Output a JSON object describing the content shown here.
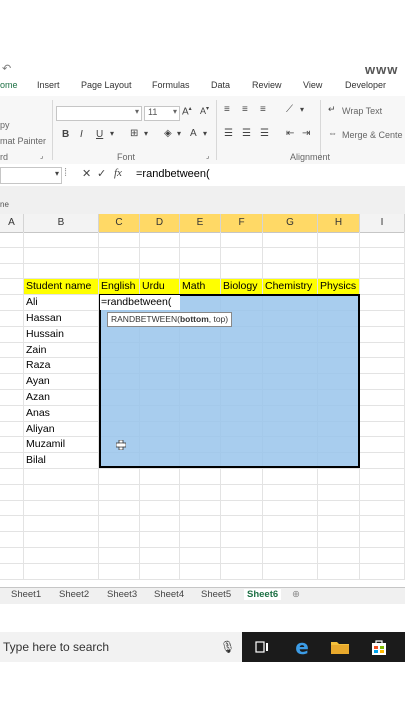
{
  "watermark": "www",
  "ribbon_tabs": [
    "ome",
    "Insert",
    "Page Layout",
    "Formulas",
    "Data",
    "Review",
    "View",
    "Developer"
  ],
  "ribbon": {
    "copy_label": "py",
    "painter_label": "mat Painter",
    "clipboard_group": "rd",
    "font_size": "11",
    "font_group": "Font",
    "wrap_text": "Wrap Text",
    "merge_center": "Merge & Cente",
    "alignment_group": "Alignment"
  },
  "formula_bar": {
    "name_box": "",
    "fx": "fx",
    "content": "=randbetween("
  },
  "band_label": "ne",
  "columns": [
    "A",
    "B",
    "C",
    "D",
    "E",
    "F",
    "G",
    "H",
    "I"
  ],
  "header_row": [
    "Student name",
    "English",
    "Urdu",
    "Math",
    "Biology",
    "Chemistry",
    "Physics"
  ],
  "students": [
    "Ali",
    "Hassan",
    "Hussain",
    "Zain",
    "Raza",
    "Ayan",
    "Azan",
    "Anas",
    "Aliyan",
    "Muzamil",
    "Bilal"
  ],
  "active_cell_content": "=randbetween(",
  "tooltip": {
    "fn": "RANDBETWEEN(",
    "bold_arg": "bottom",
    "rest": ", top)"
  },
  "sheets": [
    "Sheet1",
    "Sheet2",
    "Sheet3",
    "Sheet4",
    "Sheet5",
    "Sheet6"
  ],
  "active_sheet": "Sheet6",
  "taskbar": {
    "search_placeholder": "Type here to search"
  },
  "colors": {
    "accent": "#1e7145",
    "header_fill": "#ffff00",
    "selection": "#99c4eb"
  }
}
